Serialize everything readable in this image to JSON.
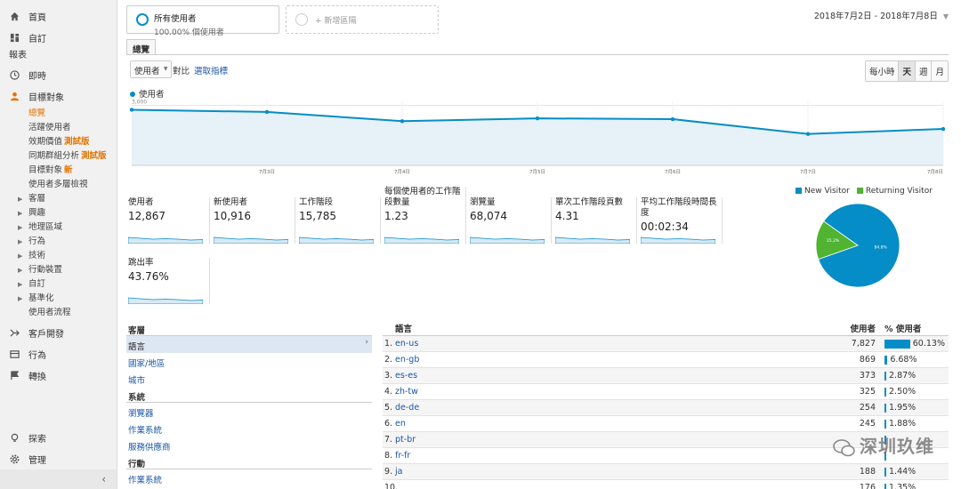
{
  "sidebar": {
    "home": "首頁",
    "custom": "自訂",
    "reports_label": "報表",
    "realtime": "即時",
    "audience": "目標對象",
    "audience_items": [
      {
        "label": "總覽",
        "active": true
      },
      {
        "label": "活躍使用者"
      },
      {
        "label": "效期價值",
        "beta": "測試版"
      },
      {
        "label": "同期群組分析",
        "beta": "測試版"
      },
      {
        "label": "目標對象",
        "beta": "新"
      },
      {
        "label": "使用者多層檢視"
      }
    ],
    "audience_groups": [
      "客層",
      "興趣",
      "地理區域",
      "行為",
      "技術",
      "行動裝置",
      "自訂",
      "基準化"
    ],
    "user_flow": "使用者流程",
    "acquisition": "客戶開發",
    "behavior": "行為",
    "conversions": "轉換",
    "discover": "探索",
    "admin": "管理",
    "collapse": "‹"
  },
  "segments": {
    "all_users": "所有使用者",
    "all_users_sub": "100.00% 個使用者",
    "add_segment": "+ 新增區隔"
  },
  "date_range": "2018年7月2日 - 2018年7月8日",
  "overview_tab": "總覽",
  "controls": {
    "metric": "使用者",
    "compare": "對比",
    "select_metric": "選取指標",
    "intervals": [
      {
        "label": "每小時"
      },
      {
        "label": "天",
        "selected": true
      },
      {
        "label": "週"
      },
      {
        "label": "月"
      }
    ]
  },
  "chart_data": {
    "type": "area",
    "series": [
      {
        "name": "使用者",
        "values": [
          2780,
          2670,
          2210,
          2350,
          2310,
          1570,
          1820
        ]
      }
    ],
    "x": [
      "7月2日",
      "7月3日",
      "7月4日",
      "7月5日",
      "7月6日",
      "7月7日",
      "7月8日"
    ],
    "x_tick_labels": [
      "7月3日",
      "7月4日",
      "7月5日",
      "7月6日",
      "7月7日",
      "7月8日"
    ],
    "y_ticks": [
      {
        "value": 3000,
        "label": "3,000"
      },
      {
        "value": 1500,
        "label": "1,500"
      }
    ],
    "ylim": [
      0,
      3200
    ],
    "grid": true
  },
  "metrics": [
    {
      "label": "使用者",
      "value": "12,867"
    },
    {
      "label": "新使用者",
      "value": "10,916"
    },
    {
      "label": "工作階段",
      "value": "15,785"
    },
    {
      "label": "每個使用者的工作階段數量",
      "value": "1.23"
    },
    {
      "label": "瀏覽量",
      "value": "68,074"
    },
    {
      "label": "單次工作階段頁數",
      "value": "4.31"
    },
    {
      "label": "平均工作階段時間長度",
      "value": "00:02:34"
    },
    {
      "label": "跳出率",
      "value": "43.76%"
    }
  ],
  "pie": {
    "legend": [
      {
        "name": "New Visitor",
        "color": "#058dc7"
      },
      {
        "name": "Returning Visitor",
        "color": "#50b432"
      }
    ],
    "values": [
      84.8,
      15.2
    ],
    "labels": [
      "84.8%",
      "15.2%"
    ]
  },
  "dimensions": {
    "groups": [
      {
        "title": "客層",
        "items": [
          {
            "label": "語言",
            "selected": true
          },
          {
            "label": "國家/地區"
          },
          {
            "label": "城市"
          }
        ]
      },
      {
        "title": "系統",
        "items": [
          {
            "label": "瀏覽器"
          },
          {
            "label": "作業系統"
          },
          {
            "label": "服務供應商"
          }
        ]
      },
      {
        "title": "行動",
        "items": [
          {
            "label": "作業系統"
          }
        ]
      }
    ]
  },
  "table": {
    "headers": {
      "lang": "語言",
      "users": "使用者",
      "pct": "% 使用者"
    },
    "rows": [
      {
        "idx": "1.",
        "lang": "en-us",
        "users": "7,827",
        "pct": "60.13%",
        "frac": 0.6013
      },
      {
        "idx": "2.",
        "lang": "en-gb",
        "users": "869",
        "pct": "6.68%",
        "frac": 0.0668
      },
      {
        "idx": "3.",
        "lang": "es-es",
        "users": "373",
        "pct": "2.87%",
        "frac": 0.0287
      },
      {
        "idx": "4.",
        "lang": "zh-tw",
        "users": "325",
        "pct": "2.50%",
        "frac": 0.025
      },
      {
        "idx": "5.",
        "lang": "de-de",
        "users": "254",
        "pct": "1.95%",
        "frac": 0.0195
      },
      {
        "idx": "6.",
        "lang": "en",
        "users": "245",
        "pct": "1.88%",
        "frac": 0.0188
      },
      {
        "idx": "7.",
        "lang": "pt-br",
        "users": "",
        "pct": "",
        "frac": 0.017
      },
      {
        "idx": "8.",
        "lang": "fr-fr",
        "users": "",
        "pct": "",
        "frac": 0.016
      },
      {
        "idx": "9.",
        "lang": "ja",
        "users": "188",
        "pct": "1.44%",
        "frac": 0.0144
      },
      {
        "idx": "10.",
        "lang": "",
        "users": "176",
        "pct": "1.35%",
        "frac": 0.0135
      }
    ]
  },
  "watermark": "深圳玖维"
}
